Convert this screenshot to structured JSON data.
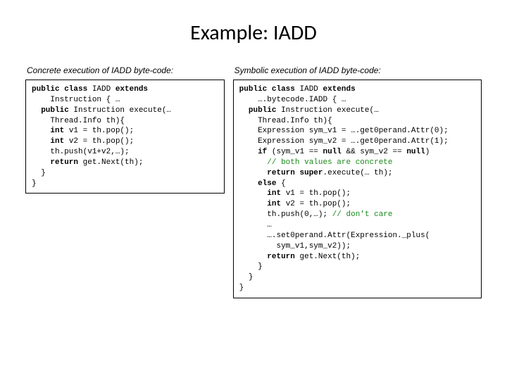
{
  "title": "Example: IADD",
  "left": {
    "caption": "Concrete execution of IADD byte-code:",
    "code": {
      "l1a": "public class",
      "l1b": " IADD ",
      "l1c": "extends",
      "l2": "    Instruction { …",
      "l3a": "  public",
      "l3b": " Instruction execute(…",
      "l4": "    Thread.Info th){",
      "l5a": "    int",
      "l5b": " v1 = th.pop();",
      "l6a": "    int",
      "l6b": " v2 = th.pop();",
      "l7": "    th.push(v1+v2,…);",
      "l8a": "    return",
      "l8b": " get.Next(th);",
      "l9": "  }",
      "l10": "}"
    }
  },
  "right": {
    "caption": "Symbolic execution of IADD byte-code:",
    "code": {
      "l1a": "public class",
      "l1b": " IADD ",
      "l1c": "extends",
      "l2": "    ….bytecode.IADD { …",
      "l3a": "  public",
      "l3b": " Instruction execute(…",
      "l4": "    Thread.Info th){",
      "l5": "    Expression sym_v1 = ….get0perand.Attr(0);",
      "l6": "    Expression sym_v2 = ….get0perand.Attr(1);",
      "l7a": "    if",
      "l7b": " (sym_v1 == ",
      "l7c": "null",
      "l7d": " && sym_v2 == ",
      "l7e": "null",
      "l7f": ")",
      "l8": "      // both values are concrete",
      "l9a": "      return super",
      "l9b": ".execute(… th);",
      "l10a": "    else",
      "l10b": " {",
      "l11a": "      int",
      "l11b": " v1 = th.pop();",
      "l12a": "      int",
      "l12b": " v2 = th.pop();",
      "l13a": "      th.push(0,…); ",
      "l13b": "// don't care",
      "l14": "      …",
      "l15": "      ….set0perand.Attr(Expression._plus(",
      "l16": "        sym_v1,sym_v2));",
      "l17a": "      return",
      "l17b": " get.Next(th);",
      "l18": "    }",
      "l19": "  }",
      "l20": "}"
    }
  }
}
